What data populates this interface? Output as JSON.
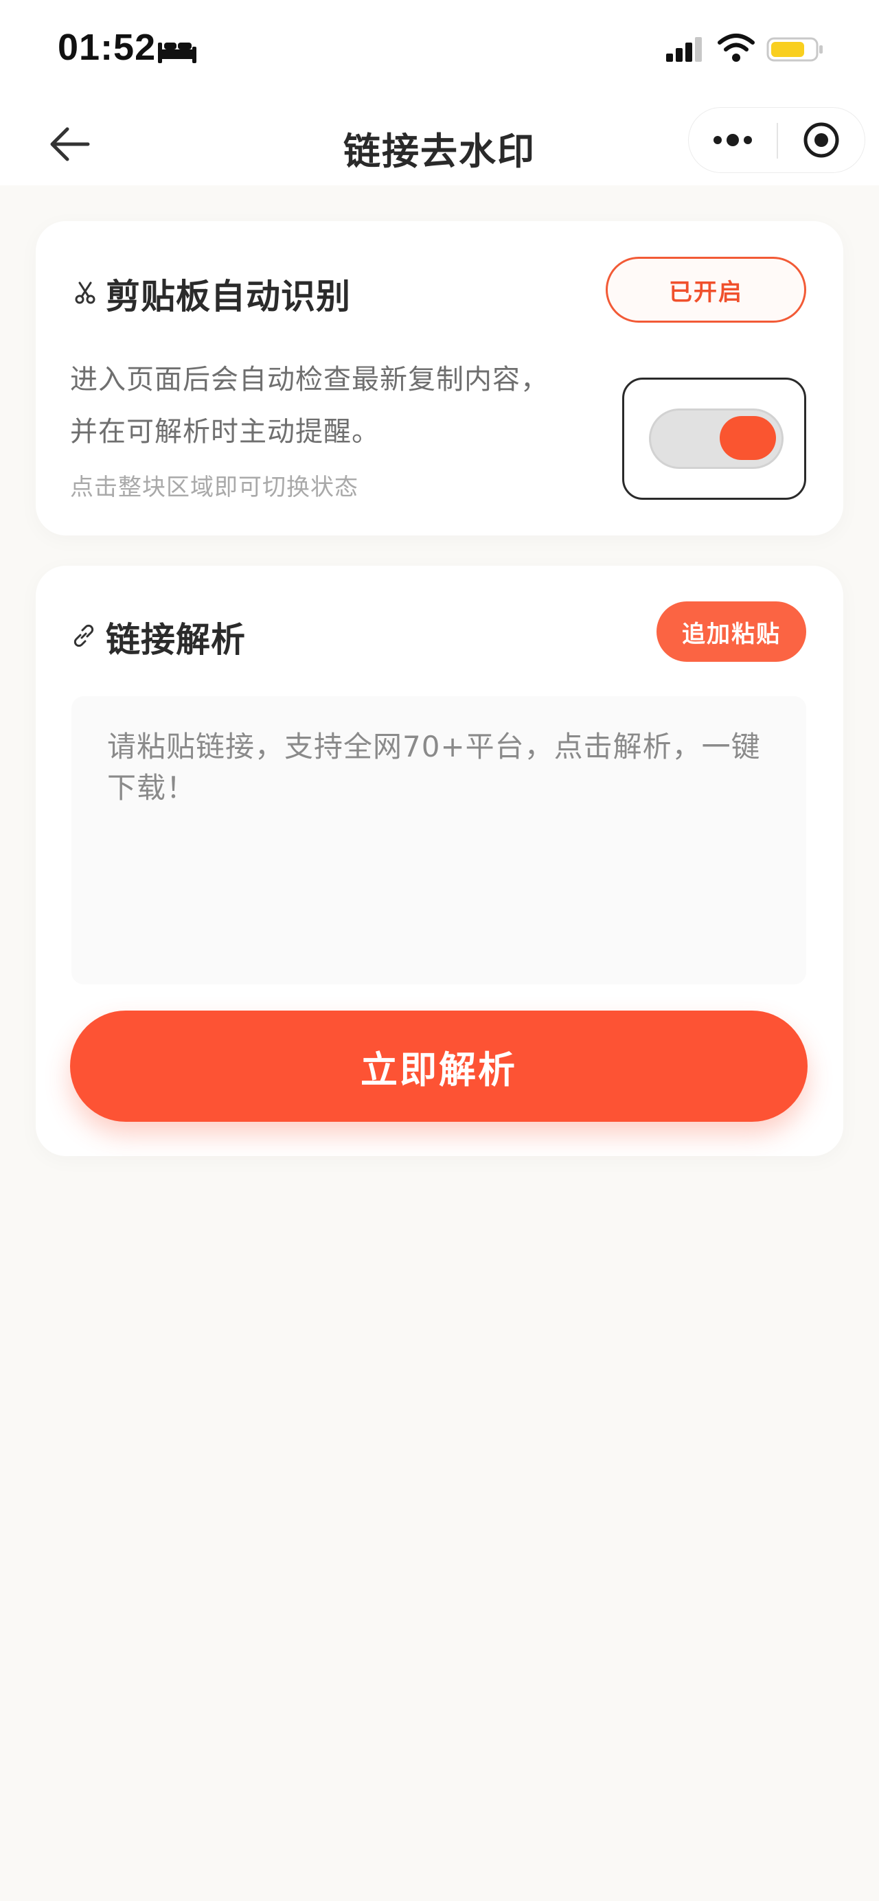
{
  "status_bar": {
    "time": "01:52",
    "battery_color": "#f9cf1f"
  },
  "nav": {
    "title": "链接去水印"
  },
  "clipboard_card": {
    "title": "剪贴板自动识别",
    "status": "已开启",
    "description_line1": "进入页面后会自动检查最新复制内容，",
    "description_line2": "并在可解析时主动提醒。",
    "hint": "点击整块区域即可切换状态",
    "toggle_on": true
  },
  "parse_card": {
    "title": "链接解析",
    "append_paste_label": "追加粘贴",
    "textarea_placeholder": "请粘贴链接，支持全网70+平台，点击解析，一键下载！",
    "parse_button_label": "立即解析"
  },
  "colors": {
    "accent": "#fd5334",
    "page_background": "#faf9f6",
    "card_background": "#ffffff"
  },
  "icons": {
    "sleep": "bed-icon",
    "cellular": "signal-icon",
    "wifi": "wifi-icon",
    "battery": "battery-icon",
    "back": "back-arrow-icon",
    "more": "more-dots-icon",
    "close": "target-close-icon",
    "clipboard": "scissors-icon",
    "link": "link-icon"
  }
}
